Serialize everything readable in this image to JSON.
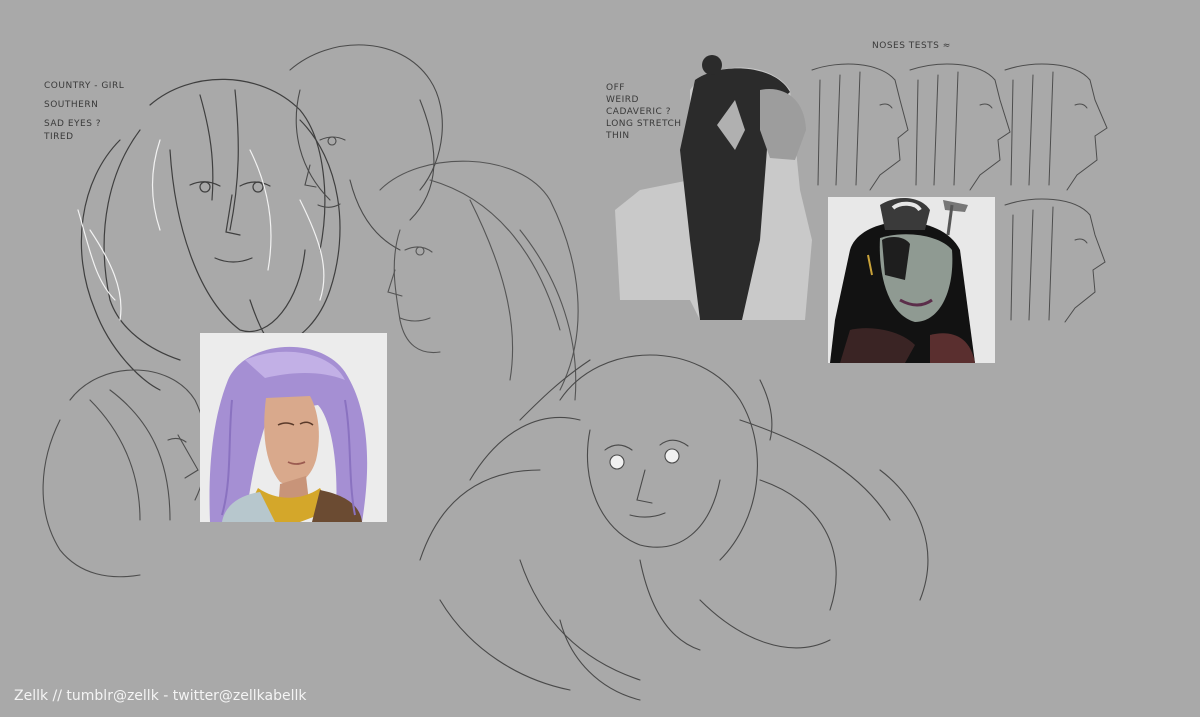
{
  "notes": {
    "country": [
      "COUNTRY - GIRL",
      "SOUTHERN",
      "SAD EYES ?",
      "TIRED"
    ],
    "elf": [
      "OFF",
      "WEIRD",
      "CADAVERIC ?",
      "LONG STRETCH",
      "THIN"
    ],
    "noses": "NOSES TESTS"
  },
  "credit": "Zellk // tumblr@zellk - twitter@zellkabellk",
  "colors": {
    "background": "#a9a9a9",
    "sketch_line": "#3a3a3a",
    "lavender_hair": "#a58fd3",
    "scarf_yellow": "#d4a72a",
    "elf_skin": "#8f9a92",
    "credit_text": "#f4f4f4"
  }
}
